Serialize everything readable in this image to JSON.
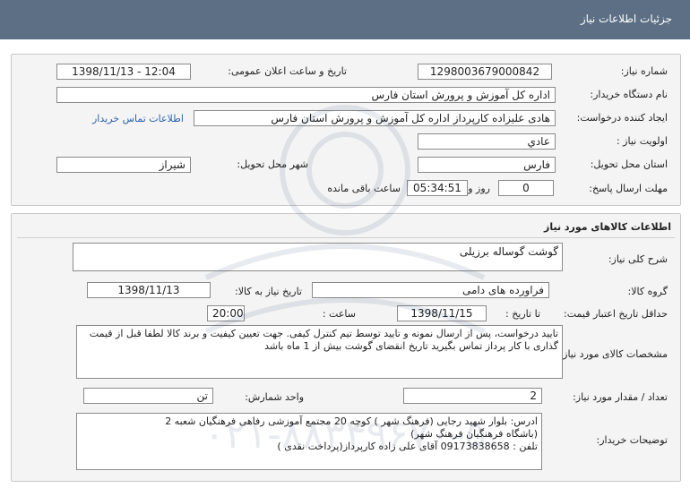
{
  "header": {
    "title": "جزئیات اطلاعات نیاز"
  },
  "need_info": {
    "need_number_label": "شماره نیاز:",
    "need_number": "1298003679000842",
    "announce_label": "تاریخ و ساعت اعلان عمومی:",
    "announce_value": "1398/11/13 - 12:04",
    "buyer_org_label": "نام دستگاه خریدار:",
    "buyer_org": "اداره کل آموزش و پرورش استان فارس",
    "creator_label": "ایجاد کننده درخواست:",
    "creator": "هادی علیزاده کارپرداز اداره کل آموزش و پرورش استان فارس",
    "contact_link": "اطلاعات تماس خریدار",
    "priority_label": "اولویت نیاز :",
    "priority": "عادي",
    "province_label": "استان محل تحویل:",
    "province": "فارس",
    "city_label": "شهر محل تحویل:",
    "city": "شیراز",
    "deadline_label": "مهلت ارسال پاسخ:",
    "days": "0",
    "days_suffix": "روز و",
    "time_left": "05:34:51",
    "time_left_suffix": "ساعت باقی مانده"
  },
  "goods": {
    "section_title": "اطلاعات کالاهای مورد نیاز",
    "general_desc_label": "شرح کلی نیاز:",
    "general_desc": "گوشت گوساله برزیلی",
    "group_label": "گروه کالا:",
    "group": "فراورده های دامی",
    "need_date_label": "تاریخ نیاز به کالا:",
    "need_date": "1398/11/13",
    "validity_label": "حداقل تاریخ اعتبار قیمت:",
    "until_label": "تا تاریخ :",
    "validity_date": "1398/11/15",
    "time_label": "ساعت :",
    "validity_time": "20:00",
    "spec_label": "مشخصات کالای مورد نیاز:",
    "spec": "تایید درخواست، پس از ارسال نمونه و تایید توسط تیم کنترل کیفی. جهت تعیین کیفیت و برند کالا لطفا قبل از قیمت گذاری با کار پرداز تماس بگیرید تاریخ انقضای گوشت بیش از 1 ماه باشد",
    "qty_label": "تعداد / مقدار مورد نیاز:",
    "qty": "2",
    "unit_label": "واحد شمارش:",
    "unit": "تن",
    "buyer_notes_label": "توضیحات خریدار:",
    "buyer_notes_lines": [
      "ادرس: بلوار شهید رجایی (فرهنگ شهر ) کوچه 20  مجتمع آموزشی رفاهی فرهنگیان شعبه 2",
      "(باشگاه فرهنگیان فرهنگ شهر)",
      "تلفن : 09173838658 آقای علی زاده کارپرداز(پرداخت نقدی  )"
    ]
  },
  "watermark": {
    "text": "۰۲۱-۸۸۳۴۹۶۷۰-۵"
  }
}
